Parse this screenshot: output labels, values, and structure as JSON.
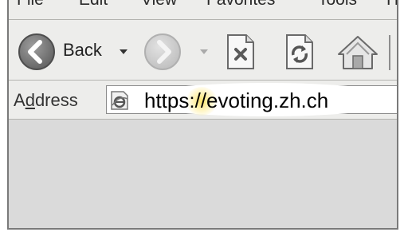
{
  "menubar": {
    "items": [
      "File",
      "Edit",
      "View",
      "Favorites",
      "Tools",
      "Help"
    ]
  },
  "toolbar": {
    "back_label": "Back",
    "icons": [
      "back-arrow-icon",
      "forward-arrow-icon",
      "stop-icon",
      "refresh-icon",
      "home-icon"
    ]
  },
  "address": {
    "label_prefix": "A",
    "label_accel": "d",
    "label_suffix": "dress",
    "url": "https://evoting.zh.ch"
  },
  "colors": {
    "highlight": "#ffe25a",
    "chrome": "#ededeb",
    "content": "#dadada"
  }
}
